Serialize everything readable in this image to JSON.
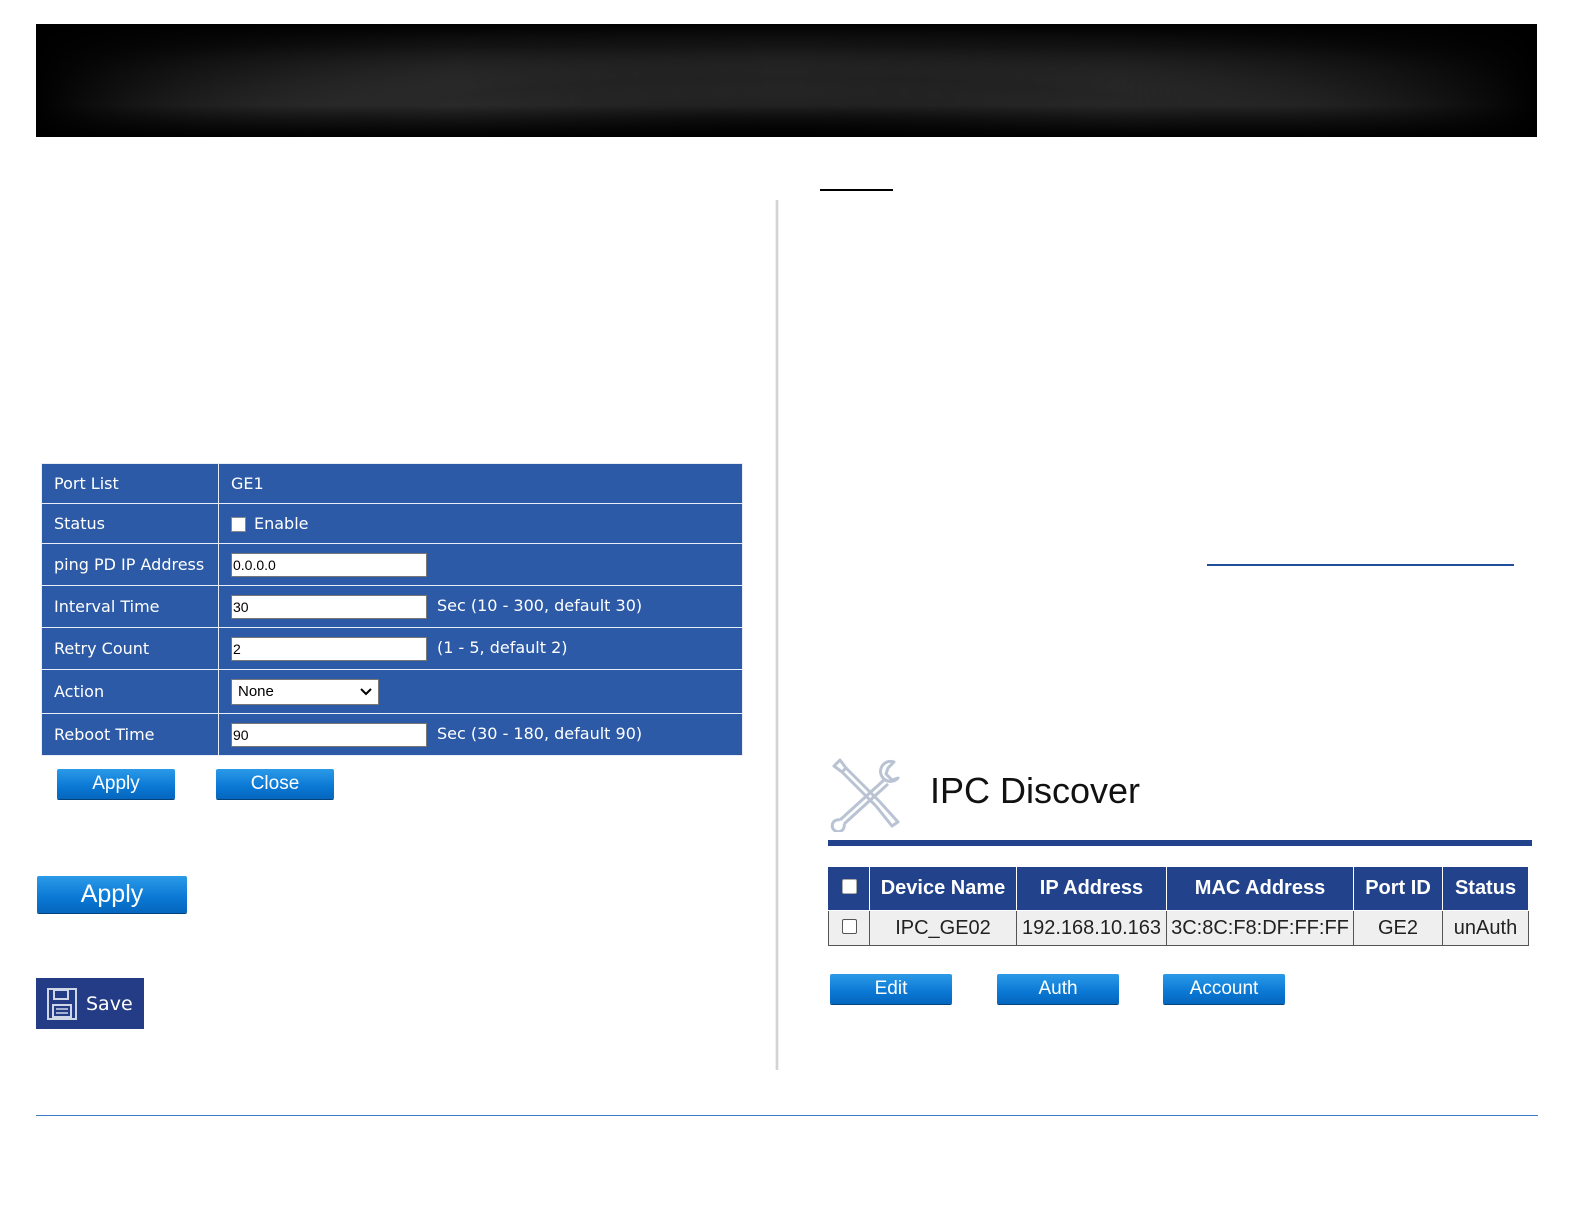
{
  "pd_form": {
    "rows": [
      {
        "label": "Port List",
        "value": "GE1"
      },
      {
        "label": "Status",
        "checkbox_label": "Enable",
        "checked": false
      },
      {
        "label": "ping PD IP Address",
        "input": "0.0.0.0"
      },
      {
        "label": "Interval Time",
        "input": "30",
        "hint": "Sec (10 - 300, default 30)"
      },
      {
        "label": "Retry Count",
        "input": "2",
        "hint": "(1 - 5, default 2)"
      },
      {
        "label": "Action",
        "select": "None"
      },
      {
        "label": "Reboot Time",
        "input": "90",
        "hint": "Sec (30 - 180, default 90)"
      }
    ],
    "apply_label": "Apply",
    "close_label": "Close"
  },
  "apply_big_label": "Apply",
  "save_label": "Save",
  "ipc": {
    "title": "IPC Discover",
    "headers": [
      "Device Name",
      "IP Address",
      "MAC Address",
      "Port ID",
      "Status"
    ],
    "rows": [
      {
        "device_name": "IPC_GE02",
        "ip": "192.168.10.163",
        "mac": "3C:8C:F8:DF:FF:FF",
        "port": "GE2",
        "status": "unAuth"
      }
    ],
    "buttons": {
      "edit": "Edit",
      "auth": "Auth",
      "account": "Account"
    }
  },
  "colors": {
    "table_blue": "#2c5aa6",
    "header_navy": "#22438c",
    "button_blue": "#0a78d4",
    "save_navy": "#233c85"
  },
  "icons": [
    "tools-icon",
    "floppy-disk-icon",
    "chevron-down-icon"
  ]
}
